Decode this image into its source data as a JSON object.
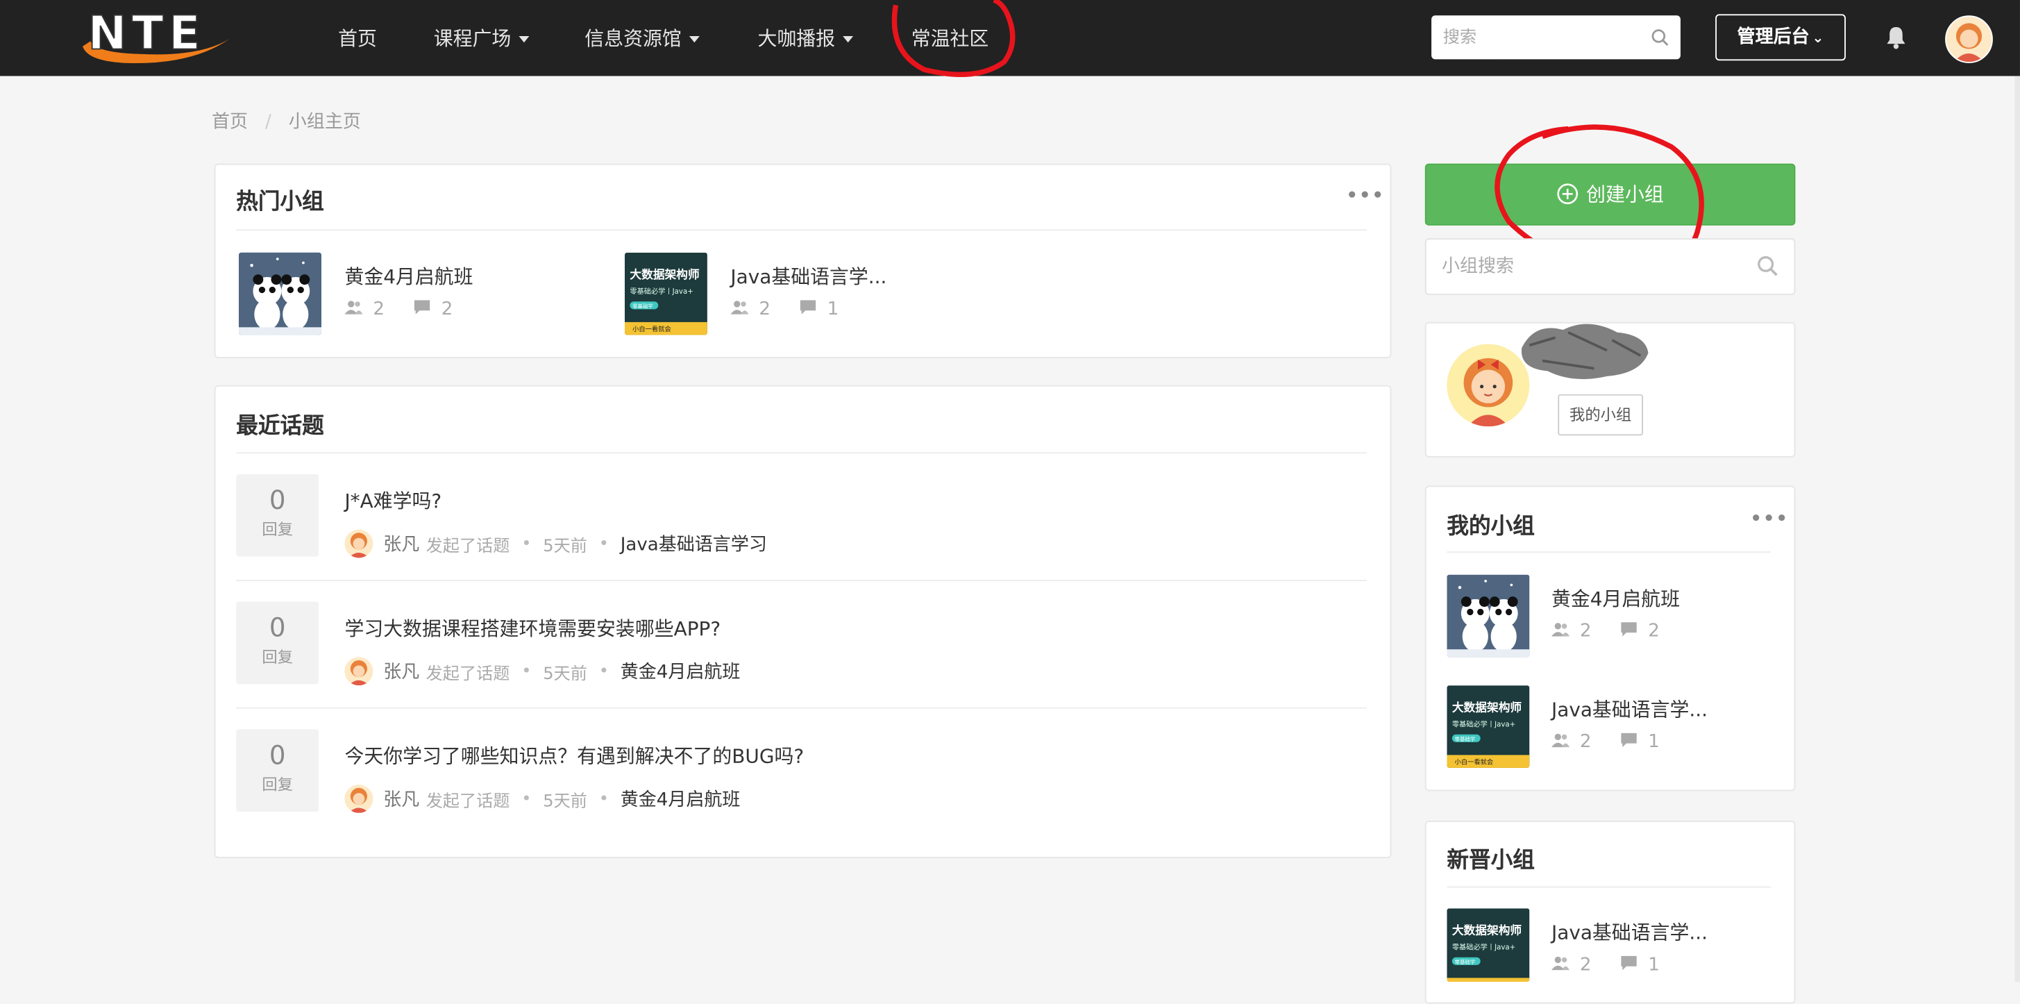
{
  "header": {
    "logo_text": "NTE",
    "nav": [
      {
        "label": "首页",
        "dropdown": false
      },
      {
        "label": "课程广场",
        "dropdown": true
      },
      {
        "label": "信息资源馆",
        "dropdown": true
      },
      {
        "label": "大咖播报",
        "dropdown": true
      },
      {
        "label": "常温社区",
        "dropdown": false
      }
    ],
    "search_placeholder": "搜索",
    "admin_label": "管理后台",
    "icons": {
      "search": "search-icon",
      "bell": "bell-icon",
      "avatar": "user-avatar"
    }
  },
  "breadcrumb": {
    "home": "首页",
    "separator": "/",
    "current": "小组主页"
  },
  "hot_groups": {
    "title": "热门小组",
    "more": "•••",
    "items": [
      {
        "name": "黄金4月启航班",
        "members": "2",
        "topics": "2",
        "thumb": "panda"
      },
      {
        "name": "Java基础语言学...",
        "members": "2",
        "topics": "1",
        "thumb": "course"
      }
    ]
  },
  "recent_topics": {
    "title": "最近话题",
    "items": [
      {
        "replies": "0",
        "replies_label": "回复",
        "title": "J*A难学吗?",
        "author": "张凡",
        "action": "发起了话题",
        "time": "5天前",
        "group": "Java基础语言学习"
      },
      {
        "replies": "0",
        "replies_label": "回复",
        "title": "学习大数据课程搭建环境需要安装哪些APP?",
        "author": "张凡",
        "action": "发起了话题",
        "time": "5天前",
        "group": "黄金4月启航班"
      },
      {
        "replies": "0",
        "replies_label": "回复",
        "title": "今天你学习了哪些知识点？有遇到解决不了的BUG吗?",
        "author": "张凡",
        "action": "发起了话题",
        "time": "5天前",
        "group": "黄金4月启航班"
      }
    ]
  },
  "sidebar": {
    "create_label": "创建小组",
    "search_placeholder": "小组搜索",
    "profile": {
      "my_groups_label": "我的小组"
    },
    "my_groups": {
      "title": "我的小组",
      "more": "•••",
      "items": [
        {
          "name": "黄金4月启航班",
          "members": "2",
          "topics": "2",
          "thumb": "panda"
        },
        {
          "name": "Java基础语言学...",
          "members": "2",
          "topics": "1",
          "thumb": "course"
        }
      ]
    },
    "new_groups": {
      "title": "新晋小组",
      "items": [
        {
          "name": "Java基础语言学...",
          "members": "2",
          "topics": "1",
          "thumb": "course"
        }
      ]
    }
  },
  "thumb_course": {
    "line1": "大数据架构师",
    "line2": "零基础必学丨Java+",
    "badge": "零基础学",
    "footer": "小白一看就会"
  },
  "colors": {
    "topbar": "#222222",
    "create_button": "#5cb85c",
    "annotation": "#e8141c"
  }
}
